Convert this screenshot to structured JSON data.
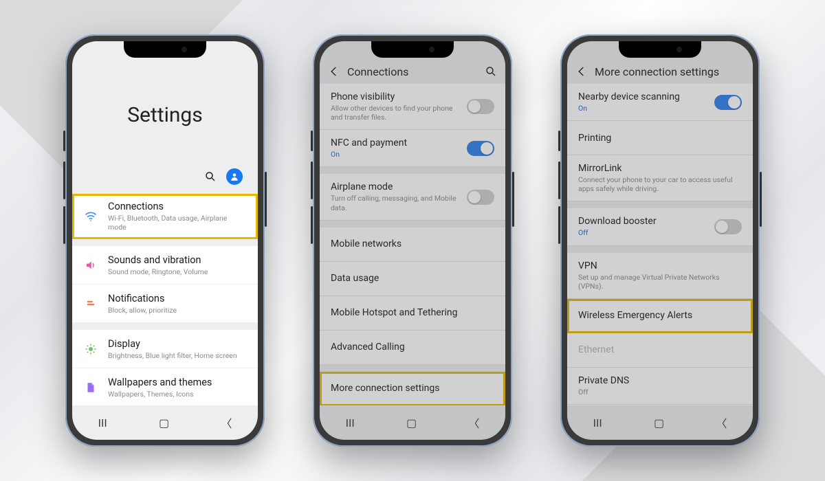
{
  "screen1": {
    "title": "Settings",
    "items": [
      {
        "title": "Connections",
        "subtitle": "Wi-Fi, Bluetooth, Data usage, Airplane mode"
      },
      {
        "title": "Sounds and vibration",
        "subtitle": "Sound mode, Ringtone, Volume"
      },
      {
        "title": "Notifications",
        "subtitle": "Block, allow, prioritize"
      },
      {
        "title": "Display",
        "subtitle": "Brightness, Blue light filter, Home screen"
      },
      {
        "title": "Wallpapers and themes",
        "subtitle": "Wallpapers, Themes, Icons"
      }
    ]
  },
  "screen2": {
    "header": "Connections",
    "items": [
      {
        "title": "Phone visibility",
        "subtitle": "Allow other devices to find your phone and transfer files.",
        "toggle": "off"
      },
      {
        "title": "NFC and payment",
        "status": "On",
        "toggle": "on"
      },
      {
        "title": "Airplane mode",
        "subtitle": "Turn off calling, messaging, and Mobile data.",
        "toggle": "off"
      },
      {
        "title": "Mobile networks"
      },
      {
        "title": "Data usage"
      },
      {
        "title": "Mobile Hotspot and Tethering"
      },
      {
        "title": "Advanced Calling"
      },
      {
        "title": "More connection settings"
      }
    ]
  },
  "screen3": {
    "header": "More connection settings",
    "items": [
      {
        "title": "Nearby device scanning",
        "status": "On",
        "toggle": "on"
      },
      {
        "title": "Printing"
      },
      {
        "title": "MirrorLink",
        "subtitle": "Connect your phone to your car to access useful apps safely while driving."
      },
      {
        "title": "Download booster",
        "status": "Off",
        "toggle": "off"
      },
      {
        "title": "VPN",
        "subtitle": "Set up and manage Virtual Private Networks (VPNs)."
      },
      {
        "title": "Wireless Emergency Alerts"
      },
      {
        "title": "Ethernet",
        "disabled": true
      },
      {
        "title": "Private DNS",
        "status": "Off"
      }
    ]
  }
}
